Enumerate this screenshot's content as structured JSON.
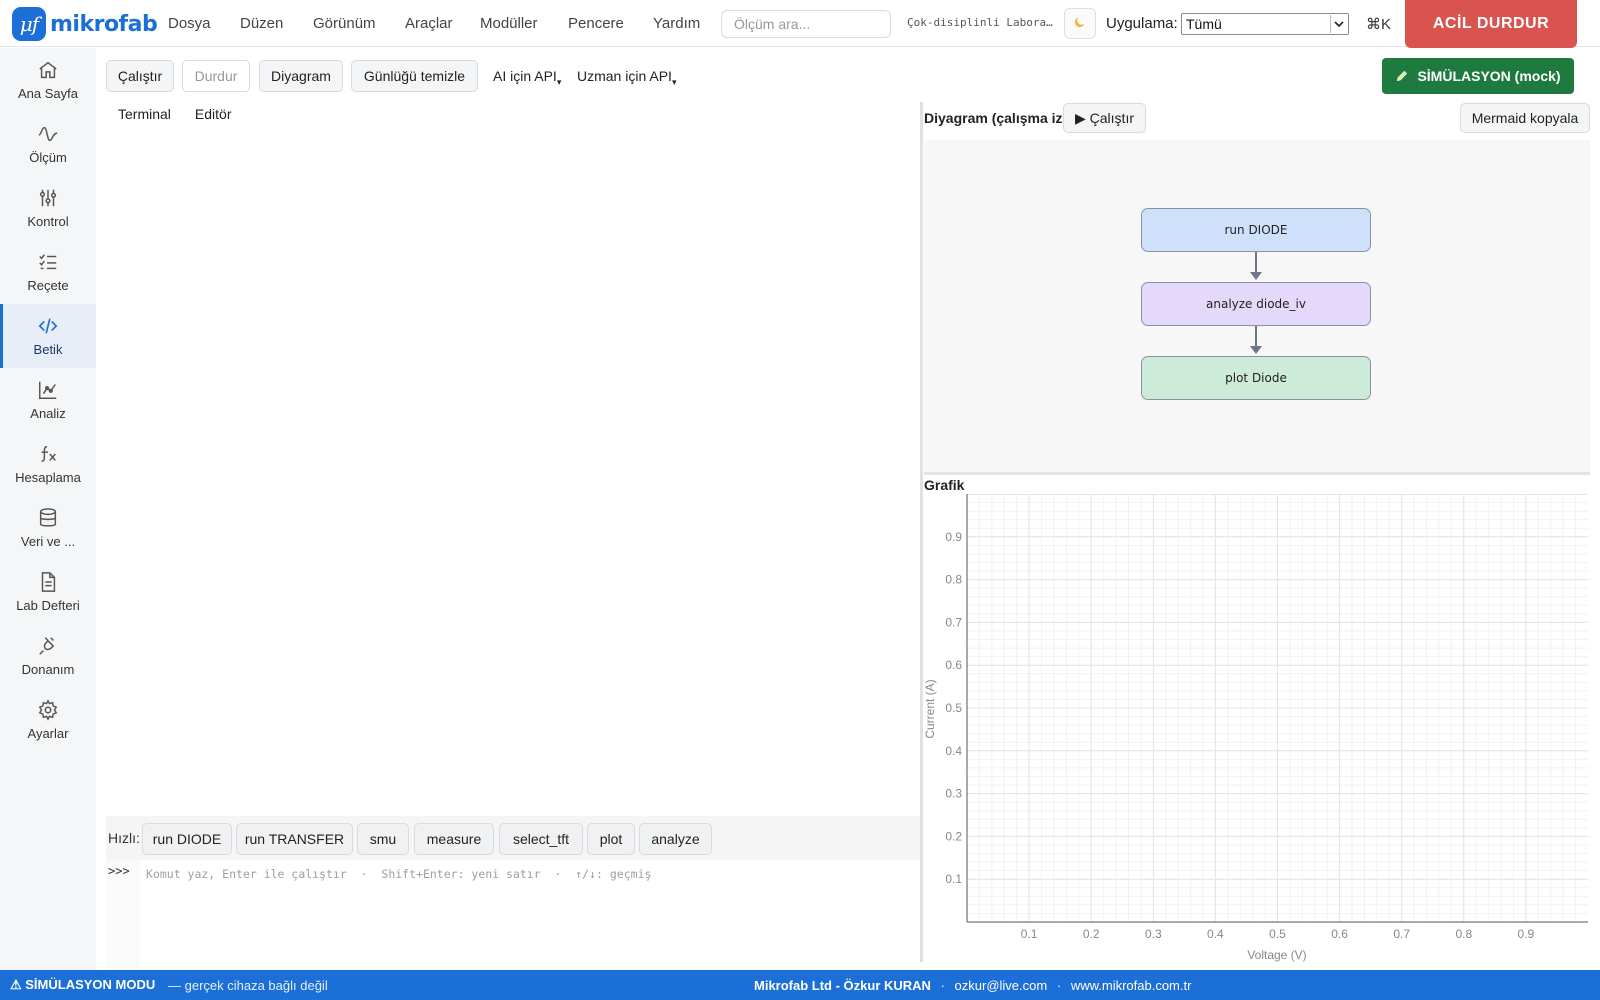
{
  "app": {
    "name": "mikrofab",
    "logo_glyph": "μf",
    "accent_color": "#1b6fd6"
  },
  "menu": {
    "items": [
      "Dosya",
      "Düzen",
      "Görünüm",
      "Araçlar",
      "Modüller",
      "Pencere",
      "Yardım"
    ]
  },
  "search": {
    "placeholder": "Ölçüm ara..."
  },
  "header": {
    "lab_name": "Çok-disiplinli Laboratuvar",
    "theme_icon": "moon-icon",
    "app_label": "Uygulama:",
    "app_select_value": "Tümü",
    "command_shortcut": "⌘K",
    "estop_label": "ACİL DURDUR",
    "estop_color": "#d9534f"
  },
  "sidebar": {
    "active_index": 4,
    "items": [
      {
        "label": "Ana Sayfa",
        "icon": "home-icon"
      },
      {
        "label": "Ölçüm",
        "icon": "waveform-icon"
      },
      {
        "label": "Kontrol",
        "icon": "sliders-icon"
      },
      {
        "label": "Reçete",
        "icon": "checklist-icon"
      },
      {
        "label": "Betik",
        "icon": "code-icon"
      },
      {
        "label": "Analiz",
        "icon": "chart-icon"
      },
      {
        "label": "Hesaplama",
        "icon": "function-icon"
      },
      {
        "label": "Veri ve ...",
        "icon": "database-icon"
      },
      {
        "label": "Lab Defteri",
        "icon": "document-icon"
      },
      {
        "label": "Donanım",
        "icon": "plug-icon"
      },
      {
        "label": "Ayarlar",
        "icon": "gear-icon"
      }
    ]
  },
  "toolbar": {
    "run_label": "Çalıştır",
    "stop_label": "Durdur",
    "diagram_label": "Diyagram",
    "clear_log_label": "Günlüğü temizle",
    "ai_api_label": "AI için API",
    "expert_api_label": "Uzman için API",
    "simulation_label": "SİMÜLASYON (mock)",
    "simulation_color": "#1e7a3e"
  },
  "editor": {
    "tabs": [
      "Terminal",
      "Editör"
    ],
    "quick_label": "Hızlı:",
    "quick_commands": [
      "run DIODE",
      "run TRANSFER",
      "smu",
      "measure",
      "select_tft",
      "plot",
      "analyze"
    ],
    "prompt": ">>>",
    "input_placeholder": "Komut yaz, Enter ile çalıştır  ·  Shift+Enter: yeni satır  ·  ↑/↓: geçmiş"
  },
  "diagram": {
    "title": "Diyagram (çalışma izi)",
    "run_label": "▶ Çalıştır",
    "copy_label": "Mermaid kopyala",
    "nodes": [
      {
        "label": "run DIODE",
        "color": "#cfe0fb"
      },
      {
        "label": "analyze diode_iv",
        "color": "#e4d9fa"
      },
      {
        "label": "plot Diode",
        "color": "#cdebd9"
      }
    ]
  },
  "chart_title": "Grafik",
  "chart_data": {
    "type": "line",
    "title": "",
    "xlabel": "Voltage (V)",
    "ylabel": "Current (A)",
    "xlim": [
      0,
      1
    ],
    "ylim": [
      0,
      1
    ],
    "x_ticks": [
      0.1,
      0.2,
      0.3,
      0.4,
      0.5,
      0.6,
      0.7,
      0.8,
      0.9
    ],
    "y_ticks": [
      0.1,
      0.2,
      0.3,
      0.4,
      0.5,
      0.6,
      0.7,
      0.8,
      0.9
    ],
    "x_tick_labels": [
      "0.1",
      "0.2",
      "0.3",
      "0.4",
      "0.5",
      "0.6",
      "0.7",
      "0.8",
      "0.9"
    ],
    "y_tick_labels": [
      "0.1",
      "0.2",
      "0.3",
      "0.4",
      "0.5",
      "0.6",
      "0.7",
      "0.8",
      "0.9"
    ],
    "grid": true,
    "series": []
  },
  "statusbar": {
    "mode_label": "⚠ SİMÜLASYON MODU",
    "mode_sub": "— gerçek cihaza bağlı değil",
    "company": "Mikrofab Ltd - Özkur KURAN",
    "email": "ozkur@live.com",
    "website": "www.mikrofab.com.tr",
    "separator": "·"
  }
}
